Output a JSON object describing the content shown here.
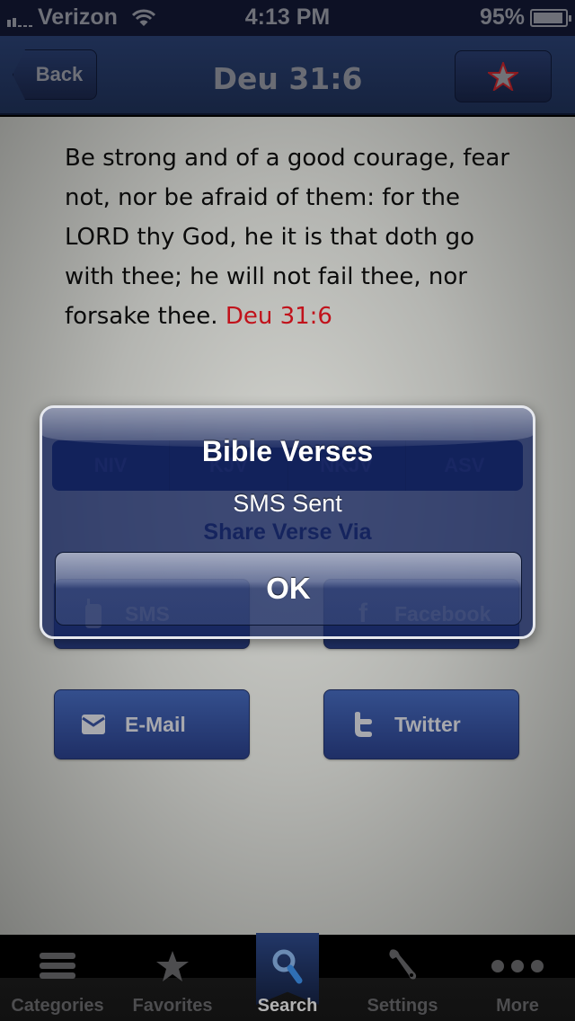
{
  "status_bar": {
    "carrier": "Verizon",
    "time": "4:13 PM",
    "battery": "95%",
    "battery_level": 0.95
  },
  "nav": {
    "back_label": "Back",
    "title": "Deu 31:6",
    "favorite_icon": "star-icon"
  },
  "verse": {
    "text": " Be strong and of a good courage, fear not, nor be afraid of them: for the LORD thy God, he it is that doth go with thee; he will not fail thee, nor forsake thee.",
    "reference": "Deu 31:6",
    "reference_color": "#c1121b"
  },
  "versions": [
    {
      "label": "NIV"
    },
    {
      "label": "KJV"
    },
    {
      "label": "NKJV"
    },
    {
      "label": "ASV"
    }
  ],
  "share": {
    "heading": "Share Verse Via",
    "buttons": [
      {
        "label": "SMS",
        "icon": "phone-icon"
      },
      {
        "label": "Facebook",
        "icon": "facebook-icon"
      },
      {
        "label": "E-Mail",
        "icon": "envelope-icon"
      },
      {
        "label": "Twitter",
        "icon": "twitter-icon"
      }
    ]
  },
  "alert": {
    "title": "Bible Verses",
    "message": "SMS Sent",
    "ok_label": "OK"
  },
  "tabs": [
    {
      "label": "Categories",
      "icon": "list-icon",
      "active": false
    },
    {
      "label": "Favorites",
      "icon": "star-icon",
      "active": false
    },
    {
      "label": "Search",
      "icon": "search-icon",
      "active": true
    },
    {
      "label": "Settings",
      "icon": "wrench-icon",
      "active": false
    },
    {
      "label": "More",
      "icon": "more-icon",
      "active": false
    }
  ]
}
